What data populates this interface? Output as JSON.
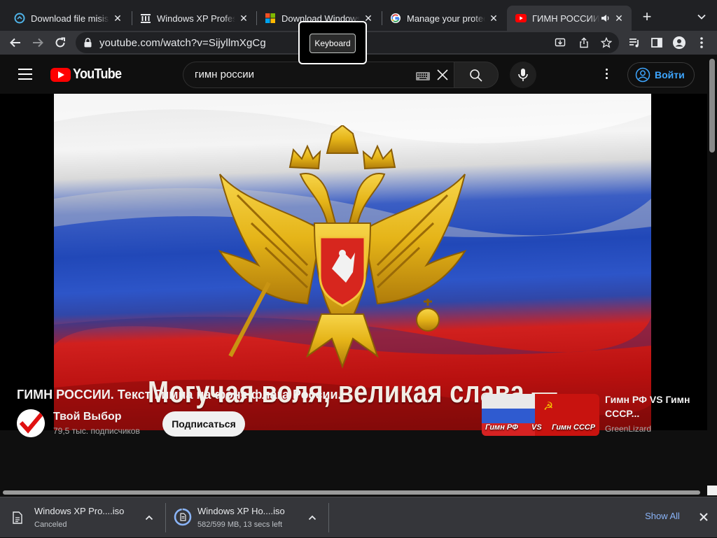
{
  "browser": {
    "tabs": [
      {
        "title": "Download file misis wp",
        "favicon": "download-site-icon"
      },
      {
        "title": "Windows XP Professional",
        "favicon": "archive-org-icon"
      },
      {
        "title": "Download Windows",
        "favicon": "microsoft-icon"
      },
      {
        "title": "Manage your protection",
        "favicon": "google-icon"
      },
      {
        "title": "ГИМН РОССИИ",
        "favicon": "youtube-icon",
        "active": true,
        "audio": true
      }
    ],
    "url": "youtube.com/watch?v=SijyllmXgCg",
    "tooltip": "Keyboard"
  },
  "youtube": {
    "logo": "YouTube",
    "search_query": "гимн россии",
    "signin_label": "Войти",
    "video": {
      "lyric": "Могучая воля, великая слава —",
      "title": "ГИМН РОССИИ. Текст Гимна на фоне флага России.",
      "channel": "Твой Выбор",
      "subscribers": "79,5 тыс. подписчиков",
      "subscribe_label": "Подписаться"
    },
    "recommended": {
      "title": "Гимн РФ VS Гимн СССР...",
      "channel": "GreenLizard",
      "thumb_left_label": "Гимн РФ",
      "thumb_vs_label": "VS",
      "thumb_right_label": "Гимн СССР"
    }
  },
  "downloads": {
    "items": [
      {
        "name": "Windows XP Pro....iso",
        "status": "Canceled"
      },
      {
        "name": "Windows XP Ho....iso",
        "status": "582/599 MB, 13 secs left",
        "progress": 0.97
      }
    ],
    "show_all_label": "Show All"
  },
  "colors": {
    "chrome_dark": "#202124",
    "chrome_toolbar": "#35363a",
    "youtube_red": "#ff0000",
    "link_blue": "#3ea6ff",
    "flag_white": "#f4f4f4",
    "flag_blue": "#2148b8",
    "flag_red": "#d1201e",
    "eagle_gold": "#e5b418"
  }
}
